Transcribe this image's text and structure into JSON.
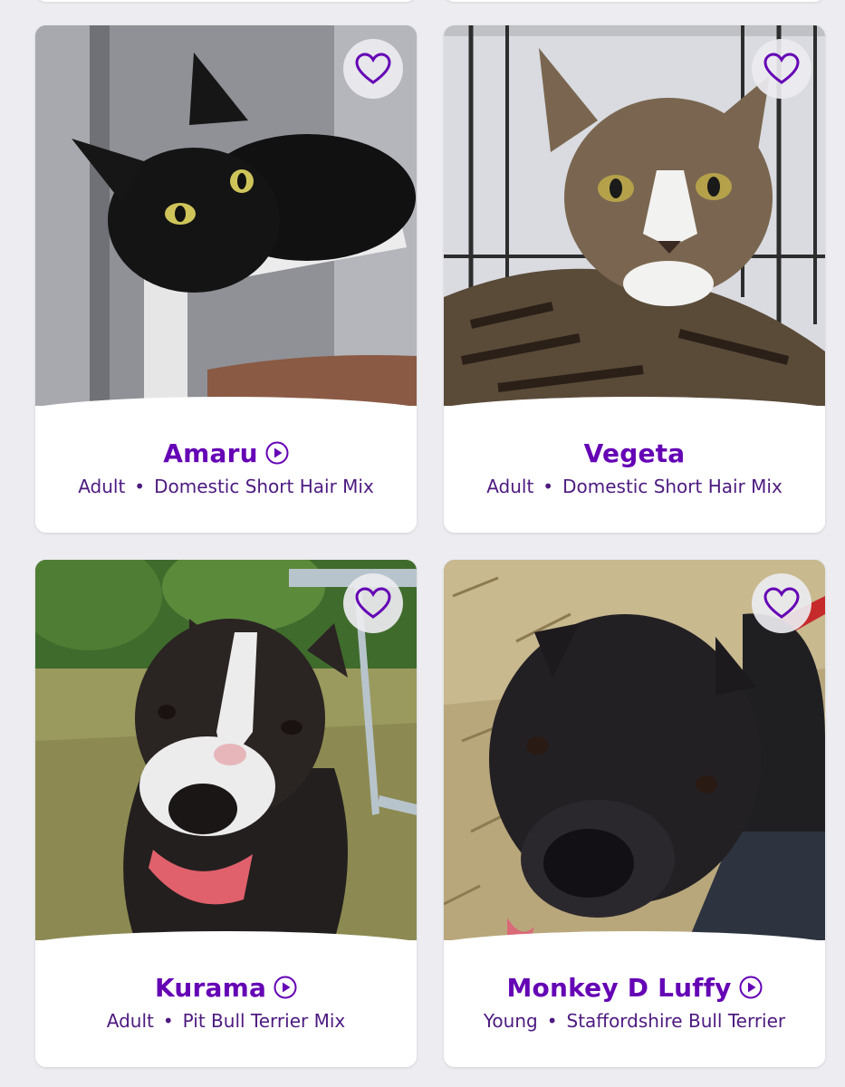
{
  "pets": [
    {
      "name": "Amaru",
      "age": "Adult",
      "breed": "Domestic Short Hair Mix",
      "has_video": true
    },
    {
      "name": "Vegeta",
      "age": "Adult",
      "breed": "Domestic Short Hair Mix",
      "has_video": false
    },
    {
      "name": "Kurama",
      "age": "Adult",
      "breed": "Pit Bull Terrier Mix",
      "has_video": true
    },
    {
      "name": "Monkey D Luffy",
      "age": "Young",
      "breed": "Staffordshire Bull Terrier",
      "has_video": true
    }
  ],
  "separator": "•",
  "icons": {
    "favorite": "heart-outline-icon",
    "video": "play-circle-icon"
  },
  "colors": {
    "accent": "#6504b5",
    "meta_text": "#4d1a80",
    "background": "#ededf1"
  }
}
